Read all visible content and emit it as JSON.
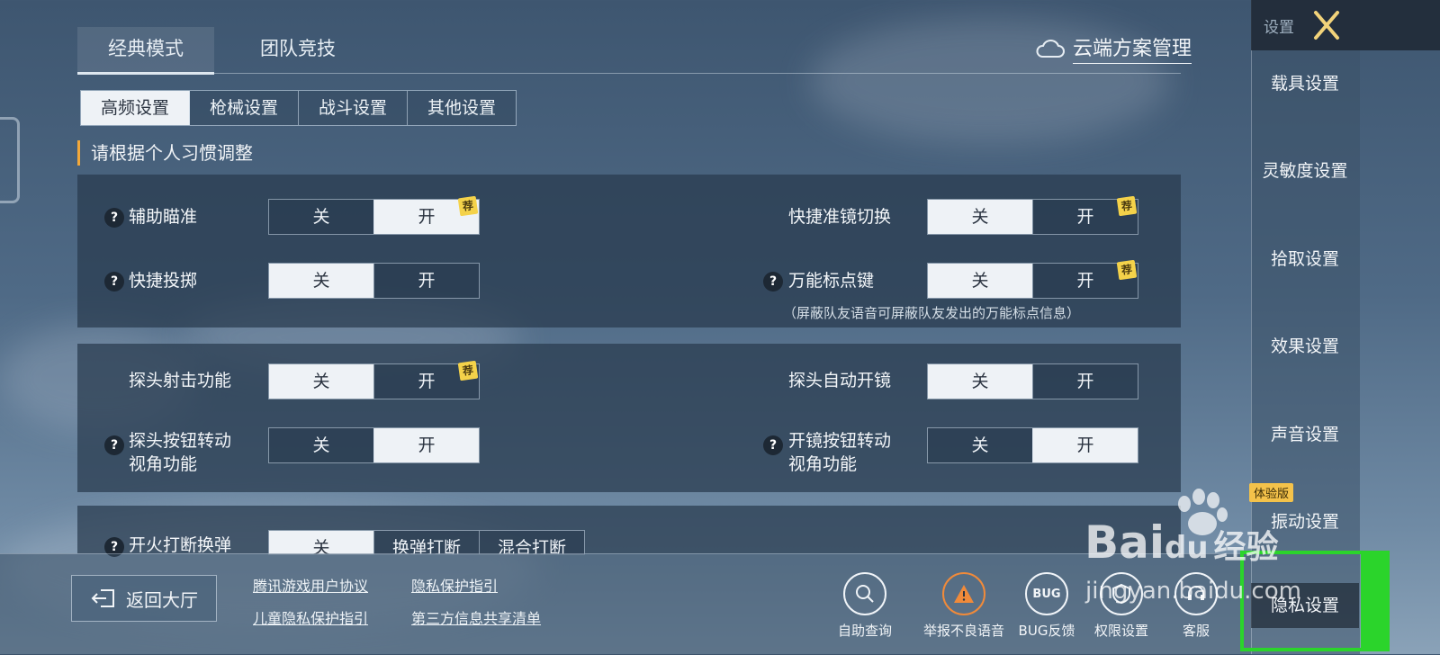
{
  "mode_tabs": [
    "经典模式",
    "团队竞技"
  ],
  "cloud_manager": "云端方案管理",
  "sub_tabs": [
    "高频设置",
    "枪械设置",
    "战斗设置",
    "其他设置"
  ],
  "section_title": "请根据个人习惯调整",
  "badge_text": "荐",
  "settings": {
    "aim_assist": {
      "label": "辅助瞄准",
      "off": "关",
      "on": "开"
    },
    "quick_throw": {
      "label": "快捷投掷",
      "off": "关",
      "on": "开"
    },
    "scope_switch": {
      "label": "快捷准镜切换",
      "off": "关",
      "on": "开"
    },
    "marker_key": {
      "label": "万能标点键",
      "off": "关",
      "on": "开",
      "note": "（屏蔽队友语音可屏蔽队友发出的万能标点信息）"
    },
    "peek_fire": {
      "label": "探头射击功能",
      "off": "关",
      "on": "开"
    },
    "peek_scope": {
      "label": "探头自动开镜",
      "off": "关",
      "on": "开"
    },
    "peek_rotate": {
      "label_1": "探头按钮转动",
      "label_2": "视角功能",
      "off": "关",
      "on": "开"
    },
    "scope_rotate": {
      "label_1": "开镜按钮转动",
      "label_2": "视角功能",
      "off": "关",
      "on": "开"
    },
    "fire_interrupt": {
      "label": "开火打断换弹",
      "opt1": "关",
      "opt2": "换弹打断",
      "opt3": "混合打断"
    }
  },
  "bottom": {
    "back": "返回大厅",
    "links": [
      "腾讯游戏用户协议",
      "隐私保护指引",
      "儿童隐私保护指引",
      "第三方信息共享清单"
    ],
    "icons": [
      {
        "label": "自助查询",
        "icon": "search-icon"
      },
      {
        "label": "举报不良语音",
        "icon": "warning-icon"
      },
      {
        "label": "BUG反馈",
        "icon": "bug-icon",
        "glyph": "BUG"
      },
      {
        "label": "权限设置",
        "icon": "shield-icon"
      },
      {
        "label": "客服",
        "icon": "headset-icon"
      }
    ]
  },
  "sidebar": {
    "title": "设置",
    "items": [
      "载具设置",
      "灵敏度设置",
      "拾取设置",
      "效果设置",
      "声音设置",
      "振动设置",
      "隐私设置"
    ],
    "experience_badge": "体验版"
  },
  "watermark": {
    "brand": "Bai",
    "brand2": "du",
    "cn": "经验",
    "url": "jingyan.baidu.com"
  }
}
